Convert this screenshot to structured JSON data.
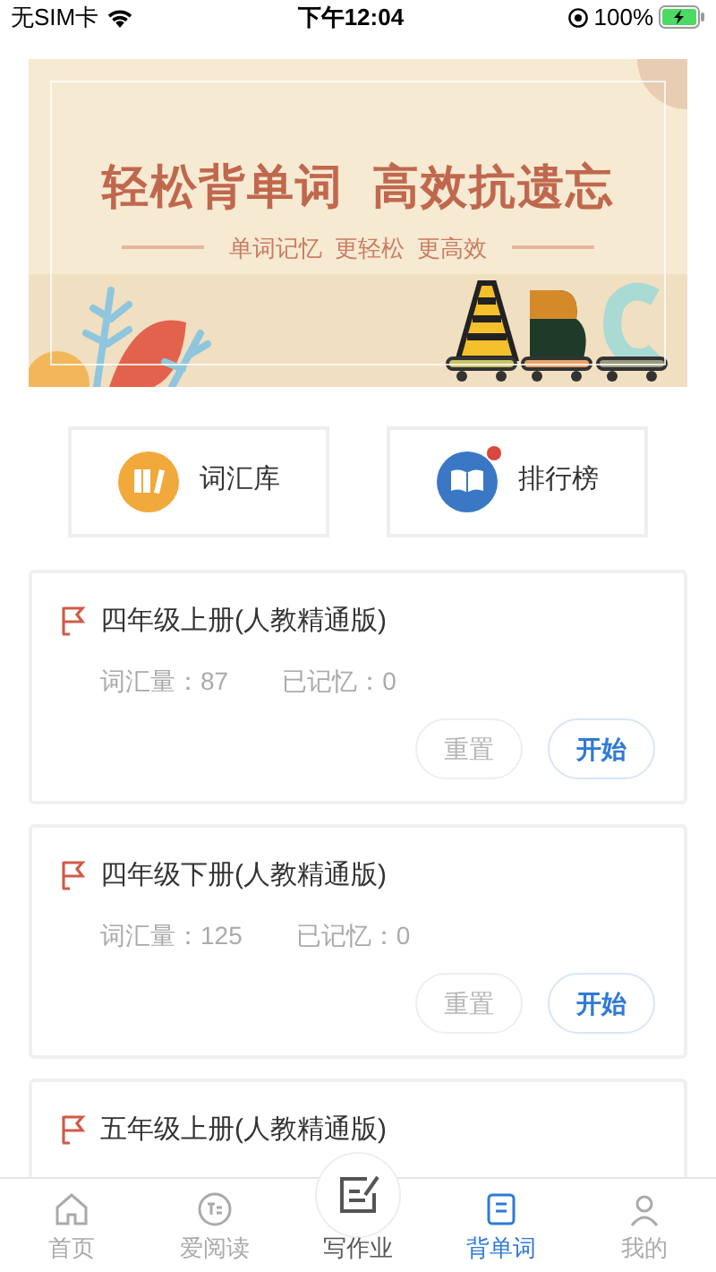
{
  "status_bar": {
    "carrier": "无SIM卡",
    "time": "下午12:04",
    "battery": "100%"
  },
  "banner": {
    "title": "轻松背单词  高效抗遗忘",
    "subtitle": "单词记忆  更轻松  更高效"
  },
  "shortcuts": [
    {
      "label": "词汇库",
      "kind": "library",
      "badge": false
    },
    {
      "label": "排行榜",
      "kind": "ranking",
      "badge": true
    }
  ],
  "books": [
    {
      "title": "四年级上册(人教精通版)",
      "vocab": "词汇量：87",
      "memorized": "已记忆：0",
      "buttons": [
        "重置",
        "开始"
      ]
    },
    {
      "title": "四年级下册(人教精通版)",
      "vocab": "词汇量：125",
      "memorized": "已记忆：0",
      "buttons": [
        "重置",
        "开始"
      ]
    },
    {
      "title": "五年级上册(人教精通版)"
    }
  ],
  "tab_bar": [
    {
      "label": "首页",
      "kind": "home",
      "selected": false
    },
    {
      "label": "爱阅读",
      "kind": "read",
      "selected": false
    },
    {
      "label": "写作业",
      "kind": "write",
      "selected": false
    },
    {
      "label": "背单词",
      "kind": "words",
      "selected": true
    },
    {
      "label": "我的",
      "kind": "me",
      "selected": false
    }
  ]
}
